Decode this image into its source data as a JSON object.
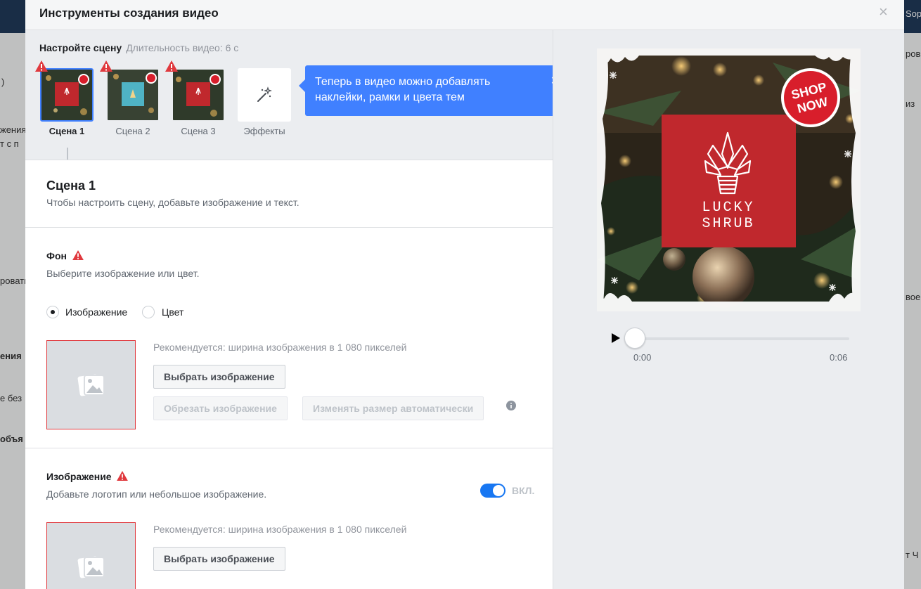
{
  "background_page": {
    "left_fragments": [
      "жения",
      "т с п",
      "ровать",
      "ения",
      "е без",
      "объя"
    ],
    "right_fragments": [
      "Sop",
      "ровь",
      "из",
      "вое",
      "т Ч"
    ]
  },
  "modal": {
    "title": "Инструменты создания видео",
    "close_label": "×"
  },
  "scenes_bar": {
    "heading": "Настройте сцену",
    "duration": "Длительность видео: 6 с",
    "scenes": [
      {
        "label": "Сцена 1",
        "active": true,
        "warning": true
      },
      {
        "label": "Сцена 2",
        "active": false,
        "warning": true
      },
      {
        "label": "Сцена 3",
        "active": false,
        "warning": true
      }
    ],
    "effects_label": "Эффекты"
  },
  "tooltip": {
    "text": "Теперь в видео можно добавлять наклейки, рамки и цвета тем",
    "close": "×"
  },
  "scene_section": {
    "title": "Сцена 1",
    "subtitle": "Чтобы настроить сцену, добавьте изображение и текст."
  },
  "background_section": {
    "title": "Фон",
    "subtitle": "Выберите изображение или цвет.",
    "option_image": "Изображение",
    "option_color": "Цвет",
    "selected": "image",
    "hint": "Рекомендуется: ширина изображения в 1 080 пикселей",
    "choose_button": "Выбрать изображение",
    "crop_button": "Обрезать изображение",
    "resize_button": "Изменять размер автоматически"
  },
  "image_section": {
    "title": "Изображение",
    "subtitle": "Добавьте логотип или небольшое изображение.",
    "toggle_label": "ВКЛ.",
    "toggle_on": true,
    "hint": "Рекомендуется: ширина изображения в 1 080 пикселей",
    "choose_button": "Выбрать изображение"
  },
  "preview": {
    "badge_line1": "SHOP",
    "badge_line2": "NOW",
    "logo_line1": "LUCKY",
    "logo_line2": "SHRUB",
    "time_start": "0:00",
    "time_end": "0:06",
    "progress": 0
  },
  "colors": {
    "accent": "#4080ff",
    "brand_red": "#c0282d",
    "warning": "#e0393e",
    "toggle_on": "#1877f2"
  },
  "icons": [
    "warning-icon",
    "magic-wand-icon",
    "image-placeholder-icon",
    "info-icon",
    "play-icon",
    "close-icon"
  ]
}
